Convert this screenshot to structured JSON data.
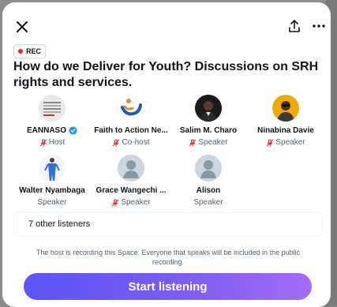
{
  "badge": {
    "label": "REC"
  },
  "space": {
    "title": "How do we Deliver for Youth? Discussions on SRH rights and services."
  },
  "participants": [
    {
      "name": "EANNASO",
      "role": "Host",
      "verified": true,
      "muted": true
    },
    {
      "name": "Faith to Action Ne...",
      "role": "Co-host",
      "verified": false,
      "muted": true
    },
    {
      "name": "Salim M. Charo",
      "role": "Speaker",
      "verified": false,
      "muted": true
    },
    {
      "name": "Ninabina Davie",
      "role": "Speaker",
      "verified": false,
      "muted": true
    },
    {
      "name": "Walter Nyambaga",
      "role": "Speaker",
      "verified": false,
      "muted": false
    },
    {
      "name": "Grace Wangechi ...",
      "role": "Speaker",
      "verified": false,
      "muted": true
    },
    {
      "name": "Alison",
      "role": "Speaker",
      "verified": false,
      "muted": false
    }
  ],
  "listeners": {
    "label": "7 other listeners"
  },
  "notice": {
    "text": "The host is recording this Space. Everyone that speaks will be included in the public recording."
  },
  "cta": {
    "label": "Start listening"
  },
  "colors": {
    "accent_start": "#5b54f4",
    "accent_end": "#a36cf6",
    "rec_red": "#f4212e",
    "mic_red": "#f4212e",
    "verified_blue": "#1d9bf0"
  }
}
